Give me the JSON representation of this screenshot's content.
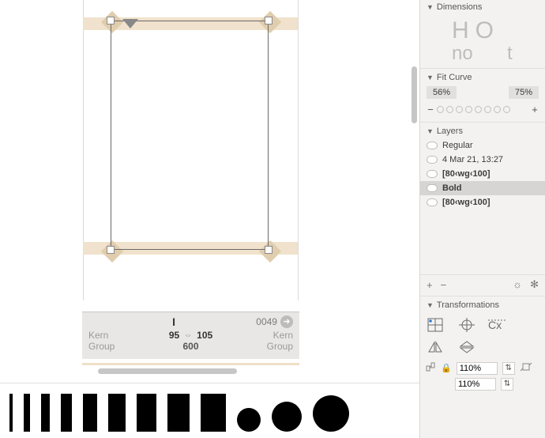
{
  "glyph": {
    "name_display": "I",
    "unicode": "0049",
    "lsb": "95",
    "rsb": "105",
    "advance_width": "600",
    "kern_label": "Kern",
    "group_label": "Group"
  },
  "sidebar": {
    "sections": {
      "dimensions": {
        "title": "Dimensions",
        "sample_top": "HO",
        "sample_bot_left": "no",
        "sample_bot_right": "t"
      },
      "fit_curve": {
        "title": "Fit Curve",
        "value_a": "56%",
        "value_b": "75%",
        "minus": "−",
        "plus": "+"
      },
      "layers": {
        "title": "Layers",
        "rows": [
          {
            "label": "Regular",
            "bold": false,
            "selected": false
          },
          {
            "label": "4 Mar 21, 13:27",
            "bold": false,
            "selected": false
          },
          {
            "label": "[80‹wg‹100]",
            "bold": true,
            "selected": false
          },
          {
            "label": "Bold",
            "bold": true,
            "selected": true
          },
          {
            "label": "[80‹wg‹100]",
            "bold": true,
            "selected": false
          }
        ],
        "toolbar": {
          "add": "+",
          "remove": "−",
          "sun": "☼",
          "gear": "✻"
        }
      },
      "transformations": {
        "title": "Transformations",
        "scale_x": "110%",
        "scale_y": "110%"
      }
    }
  },
  "preview_strip": {
    "bars_count": 9,
    "circles_count": 3
  }
}
